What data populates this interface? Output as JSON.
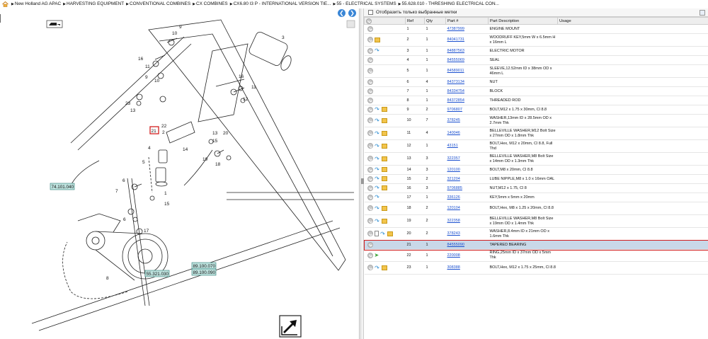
{
  "breadcrumb": {
    "items": [
      "New Holland AG APAC",
      "HARVESTING EQUIPMENT",
      "CONVENTIONAL COMBINES",
      "CX COMBINES",
      "CX6.80 I3 P - INTERNATIONAL VERSION TIE...",
      "55 - ELECTRICAL SYSTEMS",
      "55.628.010 - THRESHING ELECTRICAL CON..."
    ]
  },
  "diagram": {
    "callouts": [
      "1",
      "2",
      "3",
      "4",
      "5",
      "6",
      "7",
      "8",
      "9",
      "10",
      "11",
      "12",
      "13",
      "14",
      "15",
      "16",
      "17",
      "18",
      "19",
      "20",
      "21",
      "22",
      "23"
    ],
    "ref_labels": [
      "74.101.040",
      "55.321.030",
      "89.100.070",
      "89.100.090"
    ]
  },
  "filter": {
    "label": "Отобразить только выбранные метки"
  },
  "table": {
    "headers": [
      "Ref",
      "Qty",
      "Part #",
      "Part Description",
      "Usage"
    ],
    "rows": [
      {
        "ref": "1",
        "qty": "1",
        "part": "47387999",
        "desc": "ENGINE MOUNT",
        "icons": []
      },
      {
        "ref": "2",
        "qty": "1",
        "part": "84041731",
        "desc": "WOODRUFF KEY,5mm W x 6.5mm H x 16mm L",
        "icons": [
          "box"
        ]
      },
      {
        "ref": "3",
        "qty": "1",
        "part": "84887563",
        "desc": "ELECTRIC MOTOR",
        "icons": [
          "ref"
        ]
      },
      {
        "ref": "4",
        "qty": "1",
        "part": "84555069",
        "desc": "SEAL",
        "icons": []
      },
      {
        "ref": "5",
        "qty": "1",
        "part": "84589011",
        "desc": "SLEEVE,12.52mm ID x 38mm OD x 46mm L",
        "icons": []
      },
      {
        "ref": "6",
        "qty": "4",
        "part": "84373134",
        "desc": "NUT",
        "icons": []
      },
      {
        "ref": "7",
        "qty": "1",
        "part": "84334754",
        "desc": "BLOCK",
        "icons": []
      },
      {
        "ref": "8",
        "qty": "1",
        "part": "84372854",
        "desc": "THREADED ROD",
        "icons": []
      },
      {
        "ref": "9",
        "qty": "2",
        "part": "9706807",
        "desc": "BOLT,M12 x 1.75 x 30mm, Cl 8.8",
        "icons": [
          "ref",
          "box"
        ]
      },
      {
        "ref": "10",
        "qty": "7",
        "part": "378245",
        "desc": "WASHER,13mm ID x 28.5mm OD x 2.7mm Thk",
        "icons": [
          "ref",
          "box"
        ]
      },
      {
        "ref": "11",
        "qty": "4",
        "part": "140046",
        "desc": "BELLEVILLE WASHER,M12 Bolt Size x 27mm OD x 1.8mm Thk",
        "icons": [
          "ref",
          "box"
        ]
      },
      {
        "ref": "12",
        "qty": "1",
        "part": "43151",
        "desc": "BOLT,Hex, M12 x 20mm, Cl 8.8, Full Thd",
        "icons": [
          "ref",
          "box"
        ]
      },
      {
        "ref": "13",
        "qty": "3",
        "part": "322357",
        "desc": "BELLEVILLE WASHER,M8 Bolt Size x 14mm OD x 1.3mm Thk",
        "icons": [
          "ref",
          "box"
        ]
      },
      {
        "ref": "14",
        "qty": "3",
        "part": "120100",
        "desc": "BOLT,M8 x 20mm, Cl 8.8",
        "icons": [
          "ref",
          "box"
        ]
      },
      {
        "ref": "15",
        "qty": "2",
        "part": "321204",
        "desc": "LUBE NIPPLE,M8 x 1.0 x 16mm OAL",
        "icons": [
          "ref",
          "box"
        ]
      },
      {
        "ref": "16",
        "qty": "3",
        "part": "9706885",
        "desc": "NUT,M12 x 1.75, Cl 8",
        "icons": [
          "ref",
          "box"
        ]
      },
      {
        "ref": "17",
        "qty": "1",
        "part": "336126",
        "desc": "KEY,5mm x 5mm x 20mm",
        "icons": [
          "ref"
        ]
      },
      {
        "ref": "18",
        "qty": "2",
        "part": "120104",
        "desc": "BOLT,Hex, M8 x 1.25 x 20mm, Cl 8.8",
        "icons": [
          "ref",
          "box"
        ]
      },
      {
        "ref": "19",
        "qty": "2",
        "part": "322358",
        "desc": "BELLEVILLE WASHER,M8 Bolt Size x 19mm OD x 1.4mm Thk",
        "icons": [
          "ref",
          "box"
        ]
      },
      {
        "ref": "20",
        "qty": "2",
        "part": "378243",
        "desc": "WASHER,8.4mm ID x 21mm OD x 1.6mm Thk",
        "icons": [
          "doc",
          "ref",
          "box"
        ]
      },
      {
        "ref": "21",
        "qty": "1",
        "part": "84555090",
        "desc": "TAPERED BEARING",
        "icons": [],
        "selected": true
      },
      {
        "ref": "22",
        "qty": "1",
        "part": "220008",
        "desc": "RING,25mm ID x 37mm OD x 5mm Thk",
        "icons": [
          "grn"
        ]
      },
      {
        "ref": "23",
        "qty": "1",
        "part": "308388",
        "desc": "BOLT,Hex, M12 x 1.75 x 25mm, Cl 8.8",
        "icons": [
          "ref",
          "box"
        ]
      }
    ]
  },
  "colors": {
    "selected_row": "#c9d8e8",
    "selection_border": "#d21f1f",
    "link": "#1a4fcf",
    "nav_button": "#3a86d6",
    "ref_label_fill": "#bfe3df"
  }
}
